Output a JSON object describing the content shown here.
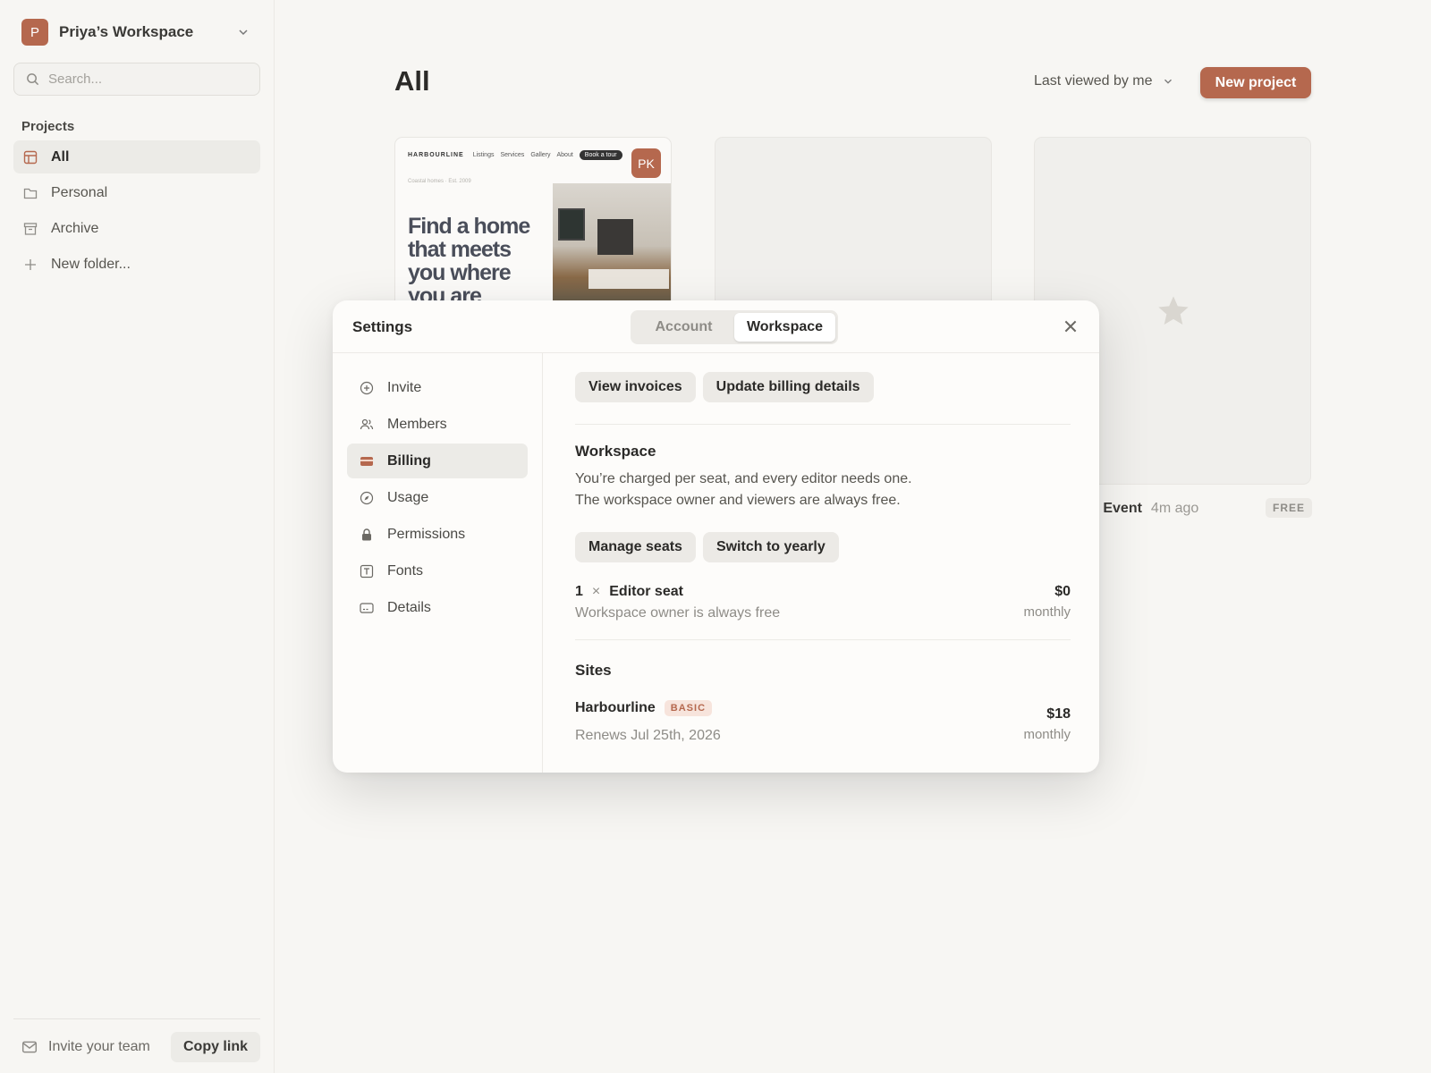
{
  "workspace": {
    "avatar_letter": "P",
    "name": "Priya’s Workspace"
  },
  "sidebar": {
    "search_placeholder": "Search...",
    "section_title": "Projects",
    "items": [
      {
        "label": "All",
        "icon": "layout-icon",
        "active": true
      },
      {
        "label": "Personal",
        "icon": "folder-icon"
      },
      {
        "label": "Archive",
        "icon": "archive-icon"
      },
      {
        "label": "New folder...",
        "icon": "plus-icon"
      }
    ],
    "footer": {
      "invite_label": "Invite your team",
      "copy_label": "Copy link"
    }
  },
  "main": {
    "title": "All",
    "sort_label": "Last viewed by me",
    "new_project_label": "New project",
    "card1": {
      "nav_brand": "HARBOURLINE",
      "nav_links": [
        "Listings",
        "Services",
        "Gallery",
        "About"
      ],
      "nav_cta": "Book a tour",
      "subtitle": "Coastal homes · Est. 2009",
      "headline": "Find a home that meets you where you are",
      "owner_badge": "PK"
    },
    "card3": {
      "name": "e Event",
      "time": "4m ago",
      "badge": "FREE"
    }
  },
  "modal": {
    "title": "Settings",
    "tabs": [
      "Account",
      "Workspace"
    ],
    "active_tab": "Workspace",
    "nav": [
      {
        "label": "Invite",
        "icon": "plus-circle-icon"
      },
      {
        "label": "Members",
        "icon": "users-icon"
      },
      {
        "label": "Billing",
        "icon": "credit-card-icon",
        "active": true
      },
      {
        "label": "Usage",
        "icon": "compass-icon"
      },
      {
        "label": "Permissions",
        "icon": "lock-icon"
      },
      {
        "label": "Fonts",
        "icon": "type-icon"
      },
      {
        "label": "Details",
        "icon": "card-icon"
      }
    ],
    "billing": {
      "view_invoices": "View invoices",
      "update_billing": "Update billing details",
      "workspace_title": "Workspace",
      "workspace_line1": "You’re charged per seat, and every editor needs one.",
      "workspace_line2": "The workspace owner and viewers are always free.",
      "manage_seats": "Manage seats",
      "switch_yearly": "Switch to yearly",
      "seat_qty": "1",
      "seat_times": "×",
      "seat_label": "Editor seat",
      "seat_note": "Workspace owner is always free",
      "seat_price": "$0",
      "seat_period": "monthly",
      "sites_title": "Sites",
      "site_name": "Harbourline",
      "site_plan": "BASIC",
      "site_renew": "Renews Jul 25th, 2026",
      "site_price": "$18",
      "site_period": "monthly"
    }
  },
  "colors": {
    "accent": "#b5684e",
    "background": "#f7f6f3"
  }
}
